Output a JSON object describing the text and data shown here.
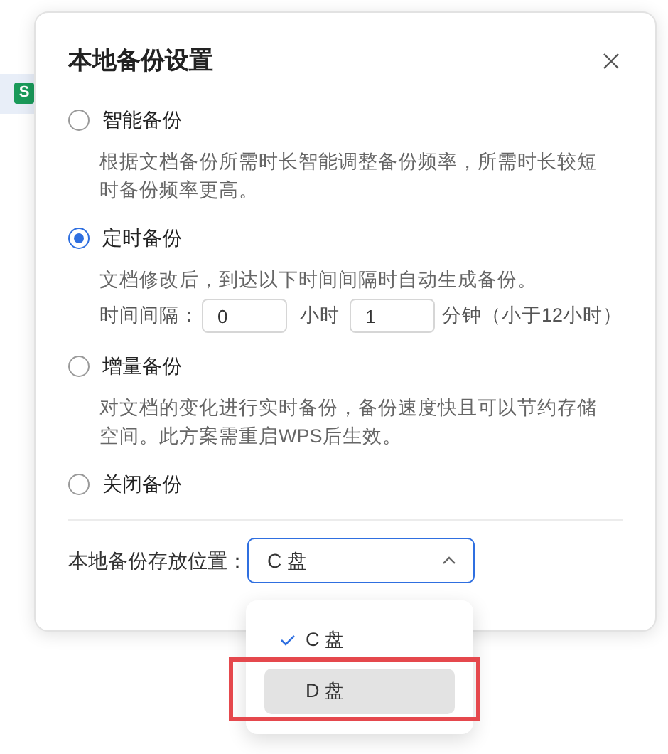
{
  "background": {
    "app_badge": "S"
  },
  "dialog": {
    "title": "本地备份设置",
    "options": [
      {
        "label": "智能备份",
        "selected": false,
        "description": "根据文档备份所需时长智能调整备份频率，所需时长较短时备份频率更高。"
      },
      {
        "label": "定时备份",
        "selected": true,
        "description": "文档修改后，到达以下时间间隔时自动生成备份。",
        "interval": {
          "label": "时间间隔：",
          "hours": "0",
          "hours_unit": "小时",
          "minutes": "1",
          "minutes_unit": "分钟（小于12小时）"
        }
      },
      {
        "label": "增量备份",
        "selected": false,
        "description": "对文档的变化进行实时备份，备份速度快且可以节约存储空间。此方案需重启WPS后生效。"
      },
      {
        "label": "关闭备份",
        "selected": false
      }
    ],
    "location": {
      "label": "本地备份存放位置：",
      "value": "C 盘",
      "expanded": true,
      "menu": [
        {
          "label": "C 盘",
          "selected": true,
          "highlighted": false,
          "framed": false
        },
        {
          "label": "D 盘",
          "selected": false,
          "highlighted": true,
          "framed": true
        }
      ]
    }
  }
}
